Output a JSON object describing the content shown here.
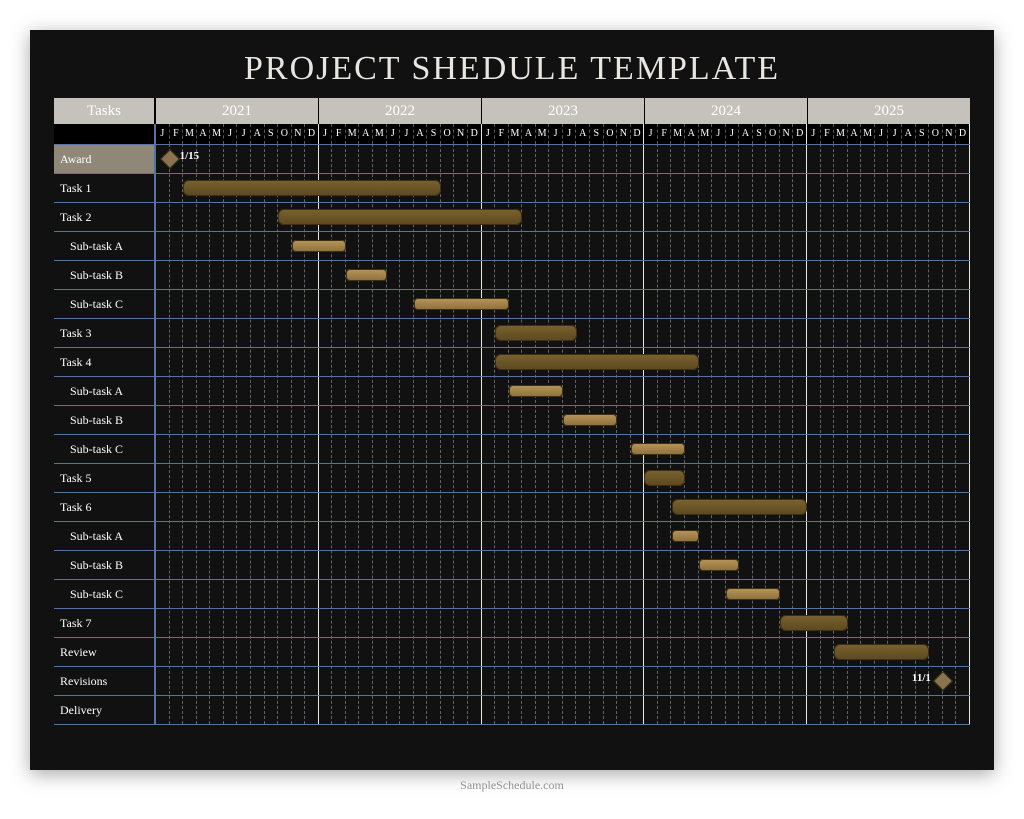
{
  "title": "PROJECT SHEDULE TEMPLATE",
  "tasks_header": "Tasks",
  "footer": "SampleSchedule.com",
  "years": [
    "2021",
    "2022",
    "2023",
    "2024",
    "2025"
  ],
  "months": [
    "J",
    "F",
    "M",
    "A",
    "M",
    "J",
    "J",
    "A",
    "S",
    "O",
    "N",
    "D"
  ],
  "chart_data": {
    "type": "gantt",
    "title": "PROJECT SHEDULE TEMPLATE",
    "xlabel": "",
    "ylabel": "Tasks",
    "x_range_months": {
      "start": "2021-01",
      "end": "2025-12",
      "count": 60
    },
    "tasks": [
      {
        "name": "Award",
        "indent": 0,
        "highlight": true,
        "milestone": {
          "month_index": 1,
          "label": "1/15"
        }
      },
      {
        "name": "Task 1",
        "indent": 0,
        "bar": {
          "start": 2,
          "end": 20
        }
      },
      {
        "name": "Task 2",
        "indent": 0,
        "bar": {
          "start": 9,
          "end": 26
        }
      },
      {
        "name": "Sub-task A",
        "indent": 1,
        "bar": {
          "start": 10,
          "end": 13
        }
      },
      {
        "name": "Sub-task B",
        "indent": 1,
        "bar": {
          "start": 14,
          "end": 16
        }
      },
      {
        "name": "Sub-task C",
        "indent": 1,
        "bar": {
          "start": 19,
          "end": 25
        }
      },
      {
        "name": "Task 3",
        "indent": 0,
        "bar": {
          "start": 25,
          "end": 30
        }
      },
      {
        "name": "Task 4",
        "indent": 0,
        "bar": {
          "start": 25,
          "end": 39
        }
      },
      {
        "name": "Sub-task A",
        "indent": 1,
        "bar": {
          "start": 26,
          "end": 29
        }
      },
      {
        "name": "Sub-task B",
        "indent": 1,
        "bar": {
          "start": 30,
          "end": 33
        }
      },
      {
        "name": "Sub-task C",
        "indent": 1,
        "bar": {
          "start": 35,
          "end": 38
        }
      },
      {
        "name": "Task 5",
        "indent": 0,
        "bar": {
          "start": 36,
          "end": 38
        }
      },
      {
        "name": "Task 6",
        "indent": 0,
        "bar": {
          "start": 38,
          "end": 47
        }
      },
      {
        "name": "Sub-task A",
        "indent": 1,
        "bar": {
          "start": 38,
          "end": 39
        }
      },
      {
        "name": "Sub-task B",
        "indent": 1,
        "bar": {
          "start": 40,
          "end": 42
        }
      },
      {
        "name": "Sub-task C",
        "indent": 1,
        "bar": {
          "start": 42,
          "end": 45
        }
      },
      {
        "name": "Task 7",
        "indent": 0,
        "bar": {
          "start": 46,
          "end": 50
        }
      },
      {
        "name": "Review",
        "indent": 0,
        "bar": {
          "start": 50,
          "end": 56
        }
      },
      {
        "name": "Revisions",
        "indent": 0,
        "milestone": {
          "month_index": 58,
          "label": "11/1",
          "label_side": "left"
        }
      },
      {
        "name": "Delivery",
        "indent": 0
      }
    ]
  }
}
